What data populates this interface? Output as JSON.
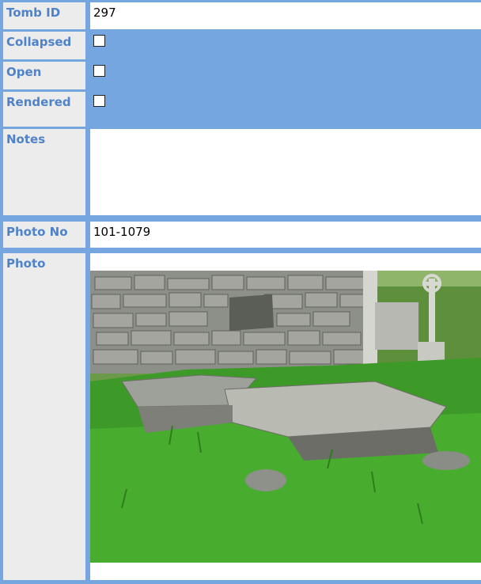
{
  "record": {
    "tomb_id": {
      "label": "Tomb ID",
      "value": "297"
    },
    "collapsed": {
      "label": "Collapsed",
      "checked": false
    },
    "open": {
      "label": "Open",
      "checked": false
    },
    "rendered": {
      "label": "Rendered",
      "checked": false
    },
    "notes": {
      "label": "Notes",
      "value": ""
    },
    "photo_no": {
      "label": "Photo No",
      "value": "101-1079"
    },
    "photo": {
      "label": "Photo",
      "description_icon": "photo-of-collapsed-stone-tomb"
    }
  },
  "colors": {
    "row_blue": "#76a6e0",
    "label_bg": "#ececec",
    "label_text": "#4f82c8",
    "value_bg": "#ffffff"
  }
}
